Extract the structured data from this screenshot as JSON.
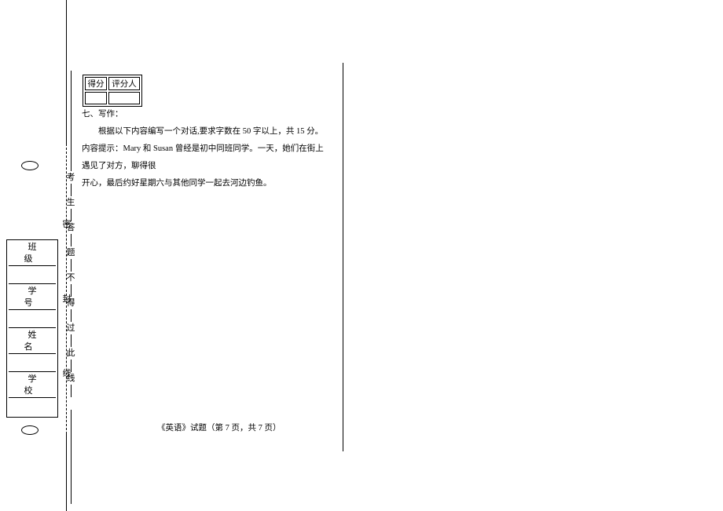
{
  "info_labels": {
    "class": "班　级",
    "number": "学　号",
    "name": "姓　名",
    "school": "学　校"
  },
  "binding_text": {
    "mi": "密",
    "feng": "封",
    "xian": "线",
    "kao": "考",
    "sheng": "生",
    "da": "答",
    "ti": "题",
    "bu": "不",
    "de": "得",
    "guo": "过",
    "ci": "此",
    "xian2": "线"
  },
  "score": {
    "h1": "得分",
    "h2": "评分人"
  },
  "section_title": "七、写作：",
  "instruction": "根据以下内容编写一个对话,要求字数在 50 字以上，共 15 分。",
  "hint_label": "内容提示：",
  "hint_part1": "Mary 和 Susan 曾经是初中同班同学。一天，她们在街上遇见了对方，聊得很",
  "hint_part2": "开心，最后约好星期六与其他同学一起去河边钓鱼。",
  "footer": "《英语》试题（第 7 页，共  7  页）"
}
